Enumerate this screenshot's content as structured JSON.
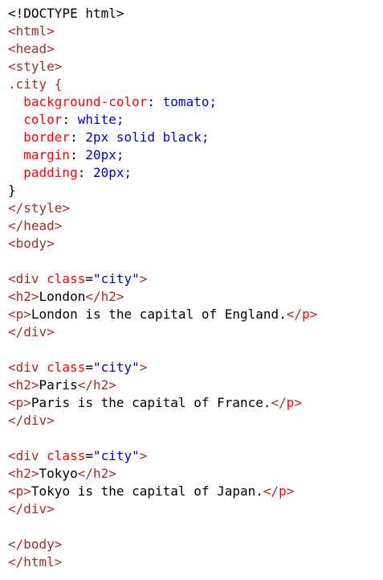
{
  "lines": {
    "l1": "<!DOCTYPE html>",
    "l2": "<html>",
    "l3": "<head>",
    "l4": "<style>",
    "l5": ".city {",
    "l6_prop": "  background-color",
    "l6_val": " tomato;",
    "l7_prop": "  color",
    "l7_val": " white;",
    "l8_prop": "  border",
    "l8_val": " 2px solid black;",
    "l9_prop": "  margin",
    "l9_val": " 20px;",
    "l10_prop": "  padding",
    "l10_val": " 20px;",
    "l11": "}",
    "l12": "</style>",
    "l13": "</head>",
    "l14": "<body>",
    "div_open_tag": "<div",
    "div_attr": " class",
    "div_eq": "=",
    "div_val": "\"city\"",
    "div_close_bracket": ">",
    "h2_open": "<h2>",
    "h2_close": "</h2>",
    "p_open": "<p>",
    "p_close_open": "</",
    "p_close_name": "p",
    "p_close_end": ">",
    "div_close": "</div>",
    "body_close": "</body>",
    "html_close": "</html>",
    "colon": ":"
  },
  "cities": [
    {
      "name": "London",
      "text": "London is the capital of England."
    },
    {
      "name": "Paris",
      "text": "Paris is the capital of France."
    },
    {
      "name": "Tokyo",
      "text": "Tokyo is the capital of Japan."
    }
  ],
  "colors": {
    "tag": "#a52a2a",
    "attribute": "#ff0000",
    "value": "#0000cd",
    "text": "#000000",
    "background": "#ffffff"
  }
}
